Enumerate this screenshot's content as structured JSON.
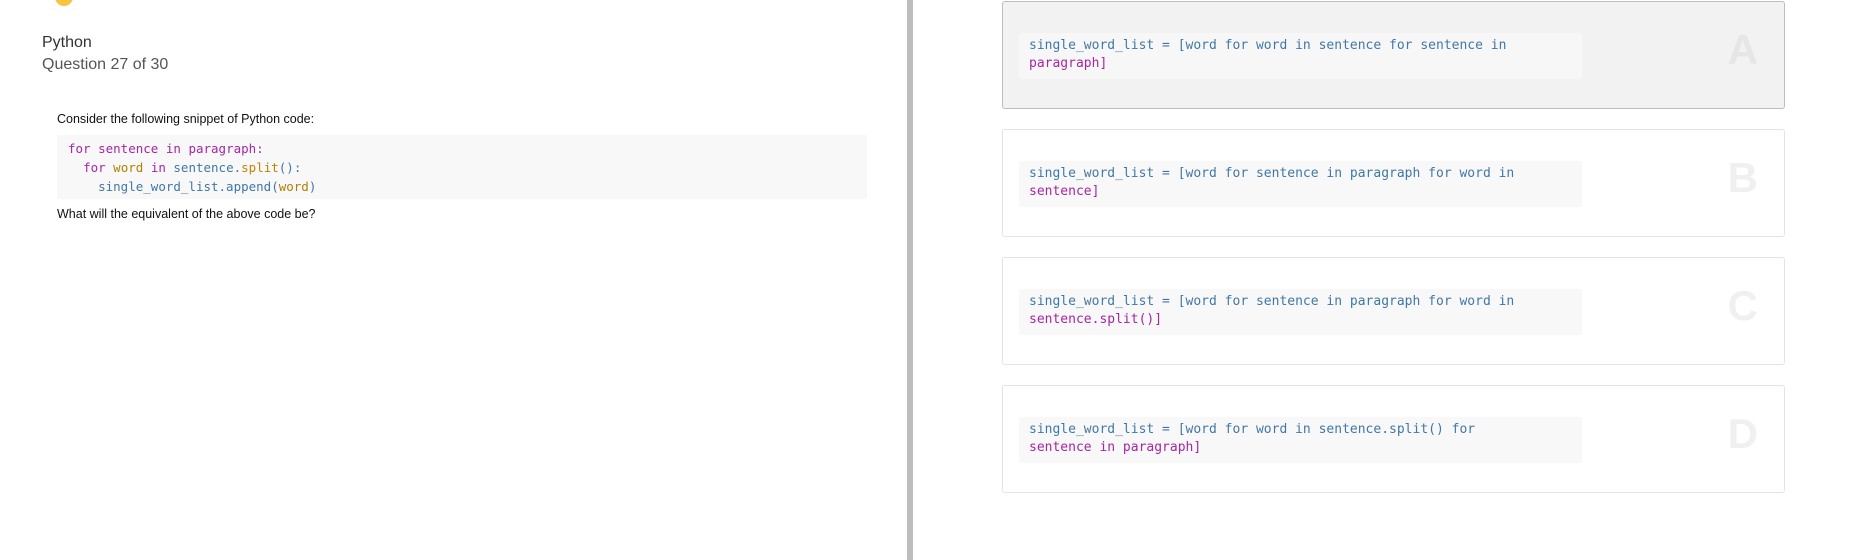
{
  "quiz": {
    "subject": "Python",
    "counter": "Question 27 of 30",
    "prompt": "Consider the following snippet of Python code:",
    "question": "What will the equivalent of the above code be?"
  },
  "code": {
    "line1": {
      "kw_for": "for",
      "t1": "sentence",
      "kw_in": "in",
      "t2": "paragraph:"
    },
    "line2": {
      "kw_for": "for",
      "t1": "word",
      "kw_in": "in",
      "t2": "sentence.",
      "fn": "split",
      "t3": "():"
    },
    "line3": {
      "t1": "single_word_list.append(",
      "arg": "word",
      "t2": ")"
    }
  },
  "options": [
    {
      "letter": "A",
      "selected": true,
      "line1": "single_word_list = [word for word in sentence for sentence in",
      "line2": "paragraph]"
    },
    {
      "letter": "B",
      "selected": false,
      "line1": "single_word_list = [word for sentence in paragraph for word in",
      "line2": "sentence]"
    },
    {
      "letter": "C",
      "selected": false,
      "line1": "single_word_list = [word for sentence in paragraph for word in",
      "line2": "sentence.split()]"
    },
    {
      "letter": "D",
      "selected": false,
      "line1": "single_word_list = [word for word in sentence.split() for",
      "line2": "sentence in paragraph]"
    }
  ],
  "colors": {
    "keyword": "#a626a4",
    "variable": "#b08000",
    "identifier": "#4078a8",
    "divider": "#bdbdbd",
    "logo": "#f4c542"
  }
}
